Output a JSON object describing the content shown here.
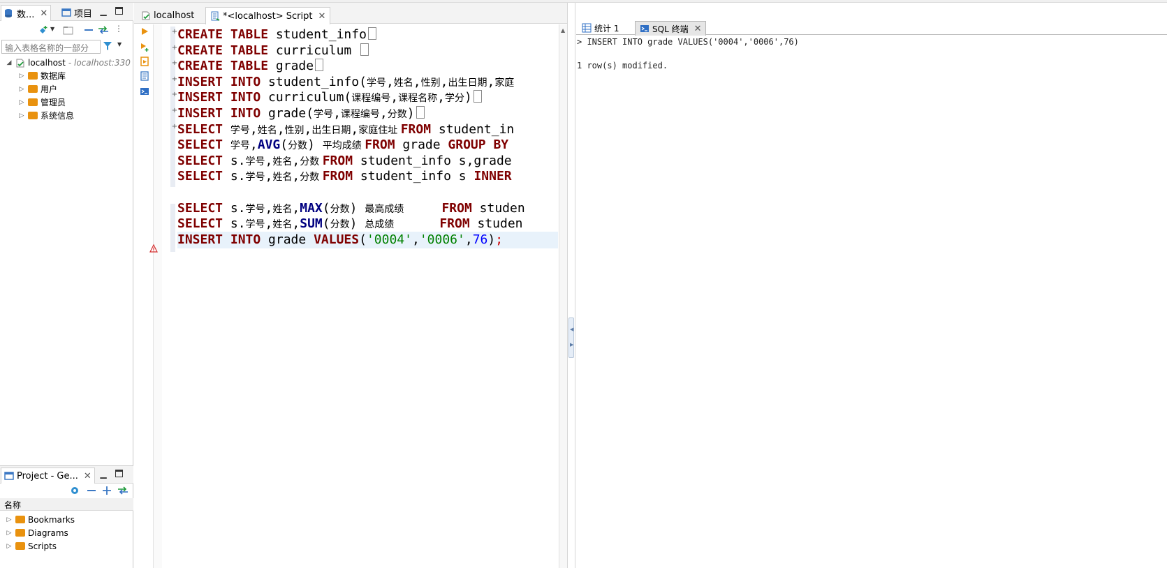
{
  "left_panel": {
    "tabs": [
      {
        "label": "数...",
        "icon": "database-navigator-icon"
      },
      {
        "label": "项目",
        "icon": "project-icon"
      }
    ],
    "filter_placeholder": "输入表格名称的一部分",
    "tree": {
      "connection": {
        "name": "localhost",
        "detail": "- localhost:330"
      },
      "children": [
        {
          "label": "数据库",
          "icon": "database-folder-icon"
        },
        {
          "label": "用户",
          "icon": "users-folder-icon"
        },
        {
          "label": "管理员",
          "icon": "admin-folder-icon"
        },
        {
          "label": "系统信息",
          "icon": "system-info-folder-icon"
        }
      ]
    }
  },
  "project_panel": {
    "tab_label": "Project - Ge...",
    "column_header": "名称",
    "items": [
      {
        "label": "Bookmarks"
      },
      {
        "label": "Diagrams"
      },
      {
        "label": "Scripts"
      }
    ]
  },
  "editor": {
    "tabs": [
      {
        "label": "localhost"
      },
      {
        "label": "*<localhost> Script"
      }
    ],
    "lines": [
      {
        "tokens": [
          [
            "kw",
            "CREATE TABLE "
          ],
          [
            "t",
            "student_info"
          ]
        ],
        "fold": "+",
        "collapsed": true
      },
      {
        "tokens": [
          [
            "kw",
            "CREATE TABLE "
          ],
          [
            "t",
            "curriculum "
          ]
        ],
        "fold": "+",
        "collapsed": true
      },
      {
        "tokens": [
          [
            "kw",
            "CREATE TABLE "
          ],
          [
            "t",
            "grade"
          ]
        ],
        "fold": "+",
        "collapsed": true
      },
      {
        "tokens": [
          [
            "kw",
            "INSERT INTO "
          ],
          [
            "t",
            "student_info("
          ],
          [
            "cjk",
            "学号"
          ],
          [
            "t",
            ","
          ],
          [
            "cjk",
            "姓名"
          ],
          [
            "t",
            ","
          ],
          [
            "cjk",
            "性别"
          ],
          [
            "t",
            ","
          ],
          [
            "cjk",
            "出生日期"
          ],
          [
            "t",
            ","
          ],
          [
            "cjk",
            "家庭"
          ]
        ],
        "fold": "+",
        "collapsed": false
      },
      {
        "tokens": [
          [
            "kw",
            "INSERT INTO "
          ],
          [
            "t",
            "curriculum("
          ],
          [
            "cjk",
            "课程编号"
          ],
          [
            "t",
            ","
          ],
          [
            "cjk",
            "课程名称"
          ],
          [
            "t",
            ","
          ],
          [
            "cjk",
            "学分"
          ],
          [
            "t",
            ")"
          ]
        ],
        "fold": "+",
        "collapsed": true
      },
      {
        "tokens": [
          [
            "kw",
            "INSERT INTO "
          ],
          [
            "t",
            "grade("
          ],
          [
            "cjk",
            "学号"
          ],
          [
            "t",
            ","
          ],
          [
            "cjk",
            "课程编号"
          ],
          [
            "t",
            ","
          ],
          [
            "cjk",
            "分数"
          ],
          [
            "t",
            ")"
          ]
        ],
        "fold": "+",
        "collapsed": true
      },
      {
        "tokens": [
          [
            "kw",
            "SELECT "
          ],
          [
            "cjk",
            "学号"
          ],
          [
            "t",
            ","
          ],
          [
            "cjk",
            "姓名"
          ],
          [
            "t",
            ","
          ],
          [
            "cjk",
            "性别"
          ],
          [
            "t",
            ","
          ],
          [
            "cjk",
            "出生日期"
          ],
          [
            "t",
            ","
          ],
          [
            "cjk",
            "家庭住址 "
          ],
          [
            "kw",
            "FROM "
          ],
          [
            "t",
            "student_in"
          ]
        ],
        "fold": "+",
        "collapsed": false
      },
      {
        "tokens": [
          [
            "kw",
            "SELECT "
          ],
          [
            "cjk",
            "学号"
          ],
          [
            "t",
            ","
          ],
          [
            "fn",
            "AVG"
          ],
          [
            "t",
            "("
          ],
          [
            "cjk",
            "分数"
          ],
          [
            "t",
            ") "
          ],
          [
            "cjk",
            "平均成绩 "
          ],
          [
            "kw",
            "FROM "
          ],
          [
            "t",
            "grade "
          ],
          [
            "kw",
            "GROUP BY"
          ]
        ],
        "fold": "",
        "collapsed": false
      },
      {
        "tokens": [
          [
            "kw",
            "SELECT "
          ],
          [
            "t",
            "s."
          ],
          [
            "cjk",
            "学号"
          ],
          [
            "t",
            ","
          ],
          [
            "cjk",
            "姓名"
          ],
          [
            "t",
            ","
          ],
          [
            "cjk",
            "分数 "
          ],
          [
            "kw",
            "FROM "
          ],
          [
            "t",
            "student_info s,grade"
          ]
        ],
        "fold": "",
        "collapsed": false
      },
      {
        "tokens": [
          [
            "kw",
            "SELECT "
          ],
          [
            "t",
            "s."
          ],
          [
            "cjk",
            "学号"
          ],
          [
            "t",
            ","
          ],
          [
            "cjk",
            "姓名"
          ],
          [
            "t",
            ","
          ],
          [
            "cjk",
            "分数 "
          ],
          [
            "kw",
            "FROM "
          ],
          [
            "t",
            "student_info s "
          ],
          [
            "kw",
            "INNER"
          ]
        ],
        "fold": "",
        "collapsed": false
      },
      {
        "tokens": [],
        "fold": "",
        "collapsed": false
      },
      {
        "tokens": [
          [
            "kw",
            "SELECT "
          ],
          [
            "t",
            "s."
          ],
          [
            "cjk",
            "学号"
          ],
          [
            "t",
            ","
          ],
          [
            "cjk",
            "姓名"
          ],
          [
            "t",
            ","
          ],
          [
            "fn",
            "MAX"
          ],
          [
            "t",
            "("
          ],
          [
            "cjk",
            "分数"
          ],
          [
            "t",
            ") "
          ],
          [
            "cjk",
            "最高成绩"
          ],
          [
            "t",
            "     "
          ],
          [
            "kw",
            "FROM "
          ],
          [
            "t",
            "studen"
          ]
        ],
        "fold": "",
        "collapsed": false
      },
      {
        "tokens": [
          [
            "kw",
            "SELECT "
          ],
          [
            "t",
            "s."
          ],
          [
            "cjk",
            "学号"
          ],
          [
            "t",
            ","
          ],
          [
            "cjk",
            "姓名"
          ],
          [
            "t",
            ","
          ],
          [
            "fn",
            "SUM"
          ],
          [
            "t",
            "("
          ],
          [
            "cjk",
            "分数"
          ],
          [
            "t",
            ") "
          ],
          [
            "cjk",
            "总成绩"
          ],
          [
            "t",
            "      "
          ],
          [
            "kw",
            "FROM "
          ],
          [
            "t",
            "studen"
          ]
        ],
        "fold": "",
        "collapsed": false
      },
      {
        "tokens": [
          [
            "kw",
            "INSERT INTO "
          ],
          [
            "t",
            "grade "
          ],
          [
            "kw",
            "VALUES"
          ],
          [
            "t",
            "("
          ],
          [
            "str",
            "'0004'"
          ],
          [
            "t",
            ","
          ],
          [
            "str",
            "'0006'"
          ],
          [
            "t",
            ","
          ],
          [
            "num",
            "76"
          ],
          [
            "t",
            ")"
          ],
          [
            "red",
            ";"
          ]
        ],
        "fold": "",
        "collapsed": false,
        "highlight": true,
        "warning": true
      }
    ]
  },
  "result_panel": {
    "tabs": [
      {
        "label": "统计 1",
        "icon": "statistics-icon"
      },
      {
        "label": "SQL 终端",
        "icon": "sql-terminal-icon"
      }
    ],
    "console_lines": [
      "> INSERT INTO grade VALUES('0004','0006',76)",
      "",
      "1 row(s) modified."
    ]
  },
  "colors": {
    "keyword": "#7f0000",
    "function": "#000080",
    "string": "#008000",
    "number": "#0000ff",
    "folder": "#e9920f",
    "accent": "#1f6fb5"
  }
}
